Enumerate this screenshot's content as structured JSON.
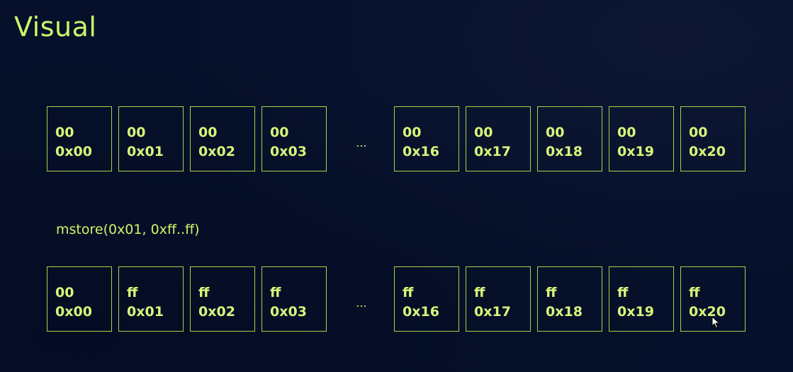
{
  "slide": {
    "title": "Visual",
    "caption": "mstore(0x01, 0xff..ff)",
    "ellipsis": "..."
  },
  "top_row": {
    "cells_left": [
      {
        "value": "00",
        "addr": "0x00"
      },
      {
        "value": "00",
        "addr": "0x01"
      },
      {
        "value": "00",
        "addr": "0x02"
      },
      {
        "value": "00",
        "addr": "0x03"
      }
    ],
    "cells_right": [
      {
        "value": "00",
        "addr": "0x16"
      },
      {
        "value": "00",
        "addr": "0x17"
      },
      {
        "value": "00",
        "addr": "0x18"
      },
      {
        "value": "00",
        "addr": "0x19"
      },
      {
        "value": "00",
        "addr": "0x20"
      }
    ]
  },
  "bottom_row": {
    "cells_left": [
      {
        "value": "00",
        "addr": "0x00"
      },
      {
        "value": "ff",
        "addr": "0x01"
      },
      {
        "value": "ff",
        "addr": "0x02"
      },
      {
        "value": "ff",
        "addr": "0x03"
      }
    ],
    "cells_right": [
      {
        "value": "ff",
        "addr": "0x16"
      },
      {
        "value": "ff",
        "addr": "0x17"
      },
      {
        "value": "ff",
        "addr": "0x18"
      },
      {
        "value": "ff",
        "addr": "0x19"
      },
      {
        "value": "ff",
        "addr": "0x20"
      }
    ]
  },
  "colors": {
    "background": "#06102a",
    "accent": "#c9f26a",
    "cell_border": "#a7d34a"
  },
  "icons": {
    "cursor": "mouse-pointer-icon"
  }
}
